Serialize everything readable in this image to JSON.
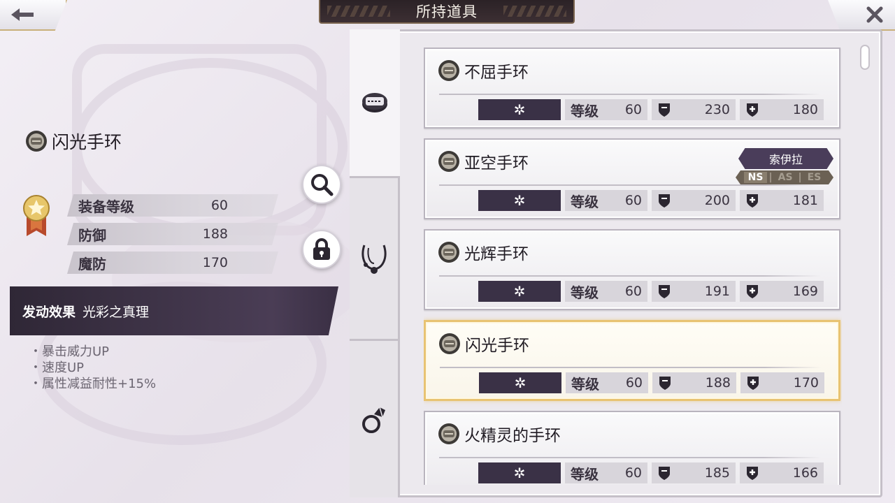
{
  "header": {
    "title": "所持道具",
    "back_icon": "left-arrow-icon",
    "close_icon": "close-x-icon"
  },
  "detail": {
    "name": "闪光手环",
    "stats": [
      {
        "label": "装备等级",
        "value": "60"
      },
      {
        "label": "防御",
        "value": "188"
      },
      {
        "label": "魔防",
        "value": "170"
      }
    ],
    "effect_label": "发动效果",
    "effect_name": "光彩之真理",
    "effects": [
      "暴击威力UP",
      "速度UP",
      "属性减益耐性+15%"
    ]
  },
  "actions": {
    "search_icon": "magnifier-icon",
    "lock_icon": "padlock-icon"
  },
  "categories": [
    {
      "icon": "bracelet-icon",
      "active": true
    },
    {
      "icon": "necklace-icon",
      "active": false
    },
    {
      "icon": "ring-icon",
      "active": false
    }
  ],
  "items": [
    {
      "name": "不屈手环",
      "level_label": "等级",
      "level": "60",
      "def": "230",
      "mdef": "180",
      "selected": false
    },
    {
      "name": "亚空手环",
      "level_label": "等级",
      "level": "60",
      "def": "200",
      "mdef": "181",
      "selected": false,
      "owner": "索伊拉",
      "series": [
        "NS",
        "AS",
        "ES"
      ],
      "series_active": "NS"
    },
    {
      "name": "光辉手环",
      "level_label": "等级",
      "level": "60",
      "def": "191",
      "mdef": "169",
      "selected": false
    },
    {
      "name": "闪光手环",
      "level_label": "等级",
      "level": "60",
      "def": "188",
      "mdef": "170",
      "selected": true
    },
    {
      "name": "火精灵的手环",
      "level_label": "等级",
      "level": "60",
      "def": "185",
      "mdef": "166",
      "selected": false
    }
  ],
  "colors": {
    "accent_gold": "#e8c372",
    "dark_slot": "#3a3146",
    "effect_bar": "#2f2736"
  }
}
